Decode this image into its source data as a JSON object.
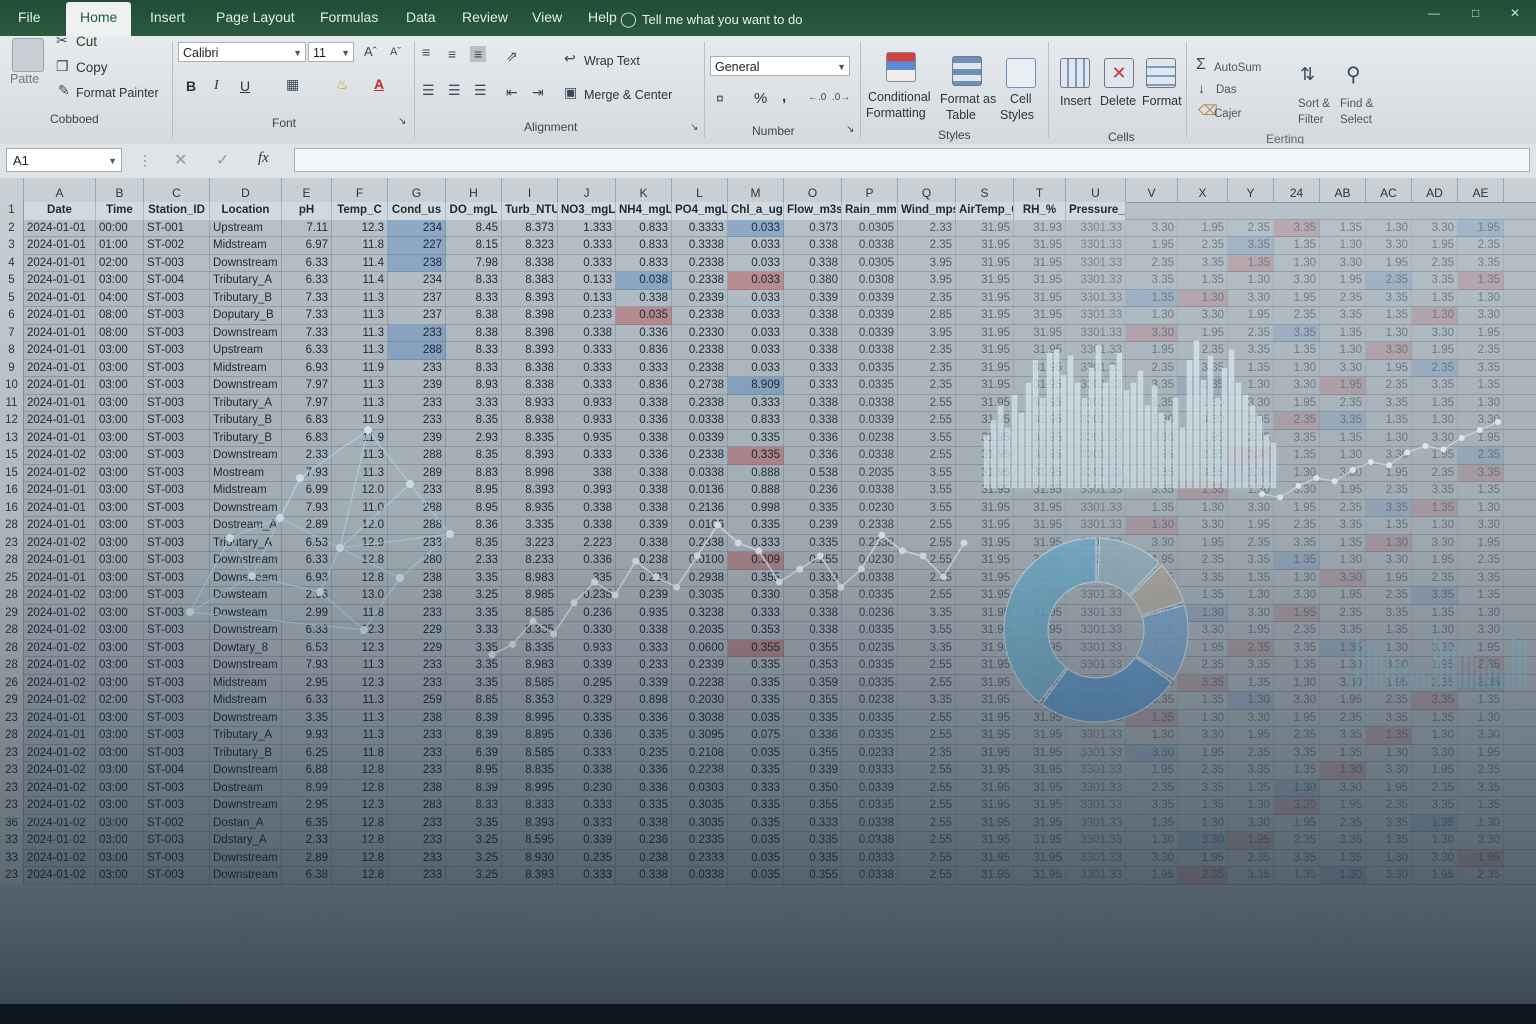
{
  "tabs": [
    "File",
    "Home",
    "Insert",
    "Page Layout",
    "Formulas",
    "Data",
    "Review",
    "View",
    "Help"
  ],
  "active_tab": "Home",
  "tell_me": "Tell me what you want to do",
  "clipboard": {
    "paste": "Patte",
    "cut": "Cut",
    "copy": "Copy",
    "format_painter": "Format Painter",
    "group": "Cobboed"
  },
  "font": {
    "family": "Calibri",
    "size": "11",
    "bold": "B",
    "italic": "I",
    "underline": "U",
    "group": "Font"
  },
  "alignment": {
    "wrap": "Wrap Text",
    "merge": "Merge & Center",
    "group": "Alignment"
  },
  "number": {
    "format": "General",
    "percent": "%",
    "comma": ",",
    "group": "Number"
  },
  "styles": {
    "cond_line1": "Conditional",
    "cond_line2": "Formatting",
    "fmt_table_line1": "Format as",
    "fmt_table_line2": "Table",
    "cell_line1": "Cell",
    "cell_line2": "Styles",
    "group": "Styles"
  },
  "cells": {
    "insert": "Insert",
    "delete": "Delete",
    "format": "Format",
    "group": "Cells"
  },
  "editing": {
    "autosum": "AutoSum",
    "fill": "Das",
    "clear": "Cajer",
    "sort_line1": "Sort &",
    "sort_line2": "Filter",
    "find_line1": "Find &",
    "find_line2": "Select",
    "group": "Eerting"
  },
  "name_box": "A1",
  "fx": "fx",
  "columns": [
    "A",
    "B",
    "C",
    "D",
    "E",
    "F",
    "G",
    "H",
    "I",
    "J",
    "K",
    "L",
    "M",
    "O",
    "P",
    "Q",
    "S",
    "T",
    "U",
    "V",
    "X",
    "Y",
    "24",
    "AB",
    "AC",
    "AD",
    "AE"
  ],
  "headers": [
    "Date",
    "Time",
    "Station_ID",
    "Location",
    "pH",
    "Temp_C",
    "Cond_us",
    "DO_mgL",
    "Turb_NTU",
    "NO3_mgL",
    "NH4_mgL",
    "PO4_mgL",
    "Chl_a_ugL",
    "Flow_m3s",
    "Rain_mm",
    "Wind_mps",
    "AirTemp_C",
    "RH_%",
    "Pressure_hPa"
  ],
  "row_numbers": [
    "2",
    "3",
    "4",
    "5",
    "5",
    "6",
    "7",
    "8",
    "9",
    "10",
    "11",
    "12",
    "13",
    "15",
    "15",
    "16",
    "16",
    "28",
    "23",
    "28",
    "25",
    "28",
    "29",
    "28",
    "28",
    "28",
    "26",
    "29",
    "23",
    "28",
    "23",
    "23",
    "23",
    "23",
    "36",
    "33",
    "33",
    "23"
  ],
  "rows": [
    [
      "2024-01-01",
      "00:00",
      "ST-001",
      "Upstream",
      "7.11",
      "12.3",
      "234",
      "8.45",
      "8.373",
      "1.333",
      "0.833",
      "0.3333",
      "0.033",
      "0.373",
      "0.0305",
      "2.33",
      "31.95",
      "31.93",
      "3301.33"
    ],
    [
      "2024-01-01",
      "01:00",
      "ST-002",
      "Midstream",
      "6.97",
      "11.8",
      "227",
      "8.15",
      "8.323",
      "0.333",
      "0.833",
      "0.3338",
      "0.033",
      "0.338",
      "0.0338",
      "2.35",
      "31.95",
      "31.95",
      "3301.33"
    ],
    [
      "2024-01-01",
      "02:00",
      "ST-003",
      "Downstream",
      "6.33",
      "11.4",
      "238",
      "7.98",
      "8.338",
      "0.333",
      "0.833",
      "0.2338",
      "0.033",
      "0.338",
      "0.0305",
      "3.95",
      "31.95",
      "31.95",
      "3301.33"
    ],
    [
      "2024-01-01",
      "03:00",
      "ST-004",
      "Tributary_A",
      "6.33",
      "11.4",
      "234",
      "8.33",
      "8.383",
      "0.133",
      "0.038",
      "0.2338",
      "0.033",
      "0.380",
      "0.0308",
      "3.95",
      "31.95",
      "31.95",
      "3301.33"
    ],
    [
      "2024-01-01",
      "04:00",
      "ST-003",
      "Tributary_B",
      "7.33",
      "11.3",
      "237",
      "8.33",
      "8.393",
      "0.133",
      "0.338",
      "0.2339",
      "0.033",
      "0.339",
      "0.0339",
      "2.35",
      "31.95",
      "31.95",
      "3301.33"
    ],
    [
      "2024-01-01",
      "08:00",
      "ST-003",
      "Doputary_B",
      "7.33",
      "11.3",
      "237",
      "8.38",
      "8.398",
      "0.233",
      "0.035",
      "0.2338",
      "0.033",
      "0.338",
      "0.0339",
      "2.85",
      "31.95",
      "31.95",
      "3301.33"
    ],
    [
      "2024-01-01",
      "08:00",
      "ST-003",
      "Downstream",
      "7.33",
      "11.3",
      "233",
      "8.38",
      "8.398",
      "0.338",
      "0.336",
      "0.2330",
      "0.033",
      "0.338",
      "0.0339",
      "3.95",
      "31.95",
      "31.95",
      "3301.33"
    ],
    [
      "2024-01-01",
      "03:00",
      "ST-003",
      "Upstream",
      "6.33",
      "11.3",
      "288",
      "8.33",
      "8.393",
      "0.333",
      "0.836",
      "0.2338",
      "0.033",
      "0.338",
      "0.0338",
      "2.35",
      "31.95",
      "31.95",
      "3301.33"
    ],
    [
      "2024-01-01",
      "03:00",
      "ST-003",
      "Midstream",
      "6.93",
      "11.9",
      "233",
      "8.33",
      "8.338",
      "0.333",
      "0.333",
      "0.2338",
      "0.033",
      "0.333",
      "0.0335",
      "2.35",
      "31.95",
      "31.95",
      "3301.33"
    ],
    [
      "2024-01-01",
      "03:00",
      "ST-003",
      "Downstream",
      "7.97",
      "11.3",
      "239",
      "8.93",
      "8.338",
      "0.333",
      "0.836",
      "0.2738",
      "8.909",
      "0.333",
      "0.0335",
      "2.35",
      "31.95",
      "31.95",
      "3301.33"
    ],
    [
      "2024-01-01",
      "03:00",
      "ST-003",
      "Tributary_A",
      "7.97",
      "11.3",
      "233",
      "3.33",
      "8.933",
      "0.933",
      "0.338",
      "0.2338",
      "0.333",
      "0.338",
      "0.0338",
      "2.55",
      "31.95",
      "31.95",
      "3301.33"
    ],
    [
      "2024-01-01",
      "03:00",
      "ST-003",
      "Tributary_B",
      "6.83",
      "11.9",
      "233",
      "8.35",
      "8.938",
      "0.933",
      "0.336",
      "0.0338",
      "0.833",
      "0.338",
      "0.0339",
      "2.55",
      "31.95",
      "31.95",
      "3301.33"
    ],
    [
      "2024-01-01",
      "03:00",
      "ST-003",
      "Tributary_B",
      "6.83",
      "11.9",
      "239",
      "2.93",
      "8.335",
      "0.935",
      "0.338",
      "0.0339",
      "0.335",
      "0.336",
      "0.0238",
      "3.55",
      "31.95",
      "31.95",
      "3301.33"
    ],
    [
      "2024-01-02",
      "03:00",
      "ST-003",
      "Downstream",
      "2.33",
      "11.3",
      "288",
      "8.35",
      "8.393",
      "0.333",
      "0.336",
      "0.2338",
      "0.335",
      "0.336",
      "0.0338",
      "2.55",
      "31.95",
      "31.95",
      "3301.33"
    ],
    [
      "2024-01-02",
      "03:00",
      "ST-003",
      "Mostream",
      "7.93",
      "11.3",
      "289",
      "8.83",
      "8.998",
      "338",
      "0.338",
      "0.0338",
      "0.888",
      "0.538",
      "0.2035",
      "3.55",
      "31.95",
      "31.95",
      "3301.33"
    ],
    [
      "2024-01-01",
      "03:00",
      "ST-003",
      "Midstream",
      "6.99",
      "12.0",
      "233",
      "8.95",
      "8.393",
      "0.393",
      "0.338",
      "0.0136",
      "0.888",
      "0.236",
      "0.0338",
      "3.55",
      "31.95",
      "31.95",
      "3301.33"
    ],
    [
      "2024-01-01",
      "03:00",
      "ST-003",
      "Downstream",
      "7.93",
      "11.0",
      "288",
      "8.95",
      "8.935",
      "0.338",
      "0.338",
      "0.2136",
      "0.998",
      "0.335",
      "0.0230",
      "3.55",
      "31.95",
      "31.95",
      "3301.33"
    ],
    [
      "2024-01-01",
      "03:00",
      "ST-003",
      "Dostream_A",
      "2.89",
      "12.0",
      "288",
      "8.36",
      "3.335",
      "0.338",
      "0.339",
      "0.0106",
      "0.335",
      "0.239",
      "0.2338",
      "2.55",
      "31.95",
      "31.95",
      "3301.33"
    ],
    [
      "2024-01-02",
      "03:00",
      "ST-003",
      "Tributary_A",
      "6.53",
      "12.9",
      "233",
      "8.35",
      "3.223",
      "2.223",
      "0.338",
      "0.2338",
      "0.333",
      "0.335",
      "0.2338",
      "2.55",
      "31.95",
      "31.95",
      "3301.33"
    ],
    [
      "2024-01-01",
      "03:00",
      "ST-003",
      "Downstream",
      "6.33",
      "12.8",
      "280",
      "2.33",
      "8.233",
      "0.336",
      "0.238",
      "0.0100",
      "0.309",
      "0.255",
      "0.0230",
      "2.55",
      "31.95",
      "31.95",
      "3301.33"
    ],
    [
      "2024-01-01",
      "03:00",
      "ST-003",
      "Downstream",
      "6.93",
      "12.8",
      "238",
      "3.35",
      "8.983",
      "335",
      "0.233",
      "0.2938",
      "0.355",
      "0.339",
      "0.0338",
      "2.55",
      "31.95",
      "31.95",
      "3301.33"
    ],
    [
      "2024-01-02",
      "03:00",
      "ST-003",
      "Dowsteam",
      "2.96",
      "13.0",
      "238",
      "3.25",
      "8.985",
      "0.235",
      "0.239",
      "0.3035",
      "0.330",
      "0.358",
      "0.0335",
      "2.55",
      "31.95",
      "31.95",
      "3301.33"
    ],
    [
      "2024-01-02",
      "03:00",
      "ST-003",
      "Dowsteam",
      "2.99",
      "11.8",
      "233",
      "3.35",
      "8.585",
      "0.236",
      "0.935",
      "0.3238",
      "0.333",
      "0.338",
      "0.0236",
      "3.35",
      "31.95",
      "31.95",
      "3301.33"
    ],
    [
      "2024-01-02",
      "03:00",
      "ST-003",
      "Downstream",
      "6.33",
      "12.3",
      "229",
      "3.33",
      "8.335",
      "0.330",
      "0.338",
      "0.2035",
      "0.353",
      "0.338",
      "0.0335",
      "3.55",
      "31.95",
      "31.95",
      "3301.33"
    ],
    [
      "2024-01-02",
      "03:00",
      "ST-003",
      "Dowtary_8",
      "6.53",
      "12.3",
      "229",
      "3.35",
      "8.335",
      "0.933",
      "0.333",
      "0.0600",
      "0.355",
      "0.355",
      "0.0235",
      "3.35",
      "31.95",
      "31.95",
      "3301.33"
    ],
    [
      "2024-01-02",
      "03:00",
      "ST-003",
      "Downstream",
      "7.93",
      "11.3",
      "233",
      "3.35",
      "8.983",
      "0.339",
      "0.233",
      "0.2339",
      "0.335",
      "0.353",
      "0.0335",
      "2.55",
      "31.95",
      "31.95",
      "3301.33"
    ],
    [
      "2024-01-02",
      "03:00",
      "ST-003",
      "Midstream",
      "2.95",
      "12.3",
      "233",
      "3.35",
      "8.585",
      "0.295",
      "0.339",
      "0.2238",
      "0.335",
      "0.359",
      "0.0335",
      "2.55",
      "31.95",
      "31.95",
      "3301.33"
    ],
    [
      "2024-01-02",
      "02:00",
      "ST-003",
      "Midstream",
      "6.33",
      "11.3",
      "259",
      "8.85",
      "8.353",
      "0.329",
      "0.898",
      "0.2030",
      "0.335",
      "0.355",
      "0.0238",
      "3.35",
      "31.95",
      "31.95",
      "3301.33"
    ],
    [
      "2024-01-01",
      "03:00",
      "ST-003",
      "Downstream",
      "3.35",
      "11.3",
      "238",
      "8.39",
      "8.995",
      "0.335",
      "0.336",
      "0.3038",
      "0.035",
      "0.335",
      "0.0335",
      "2.55",
      "31.95",
      "31.95",
      "3301.33"
    ],
    [
      "2024-01-01",
      "03:00",
      "ST-003",
      "Tributary_A",
      "9.93",
      "11.3",
      "233",
      "8.39",
      "8.895",
      "0.336",
      "0.335",
      "0.3095",
      "0.075",
      "0.336",
      "0.0335",
      "2.55",
      "31.95",
      "31.95",
      "3301.33"
    ],
    [
      "2024-01-02",
      "03:00",
      "ST-003",
      "Tributary_B",
      "6.25",
      "11.8",
      "233",
      "6.39",
      "8.585",
      "0.333",
      "0.235",
      "0.2108",
      "0.035",
      "0.355",
      "0.0233",
      "2.35",
      "31.95",
      "31.95",
      "3301.33"
    ],
    [
      "2024-01-02",
      "03:00",
      "ST-004",
      "Downstream",
      "6.88",
      "12.8",
      "233",
      "8.95",
      "8.835",
      "0.338",
      "0.336",
      "0.2238",
      "0.335",
      "0.339",
      "0.0333",
      "2.55",
      "31.95",
      "31.95",
      "3301.33"
    ],
    [
      "2024-01-02",
      "03:00",
      "ST-003",
      "Dostream",
      "8.99",
      "12.8",
      "238",
      "8.39",
      "8.995",
      "0.230",
      "0.336",
      "0.0303",
      "0.333",
      "0.350",
      "0.0339",
      "2.55",
      "31.95",
      "31.95",
      "3301.33"
    ],
    [
      "2024-01-02",
      "03:00",
      "ST-003",
      "Downstream",
      "2.95",
      "12.3",
      "283",
      "8.33",
      "8.333",
      "0.333",
      "0.335",
      "0.3035",
      "0.335",
      "0.355",
      "0.0335",
      "2.55",
      "31.95",
      "31.95",
      "3301.33"
    ],
    [
      "2024-01-02",
      "03:00",
      "ST-002",
      "Dostan_A",
      "6.35",
      "12.8",
      "233",
      "3.35",
      "8.393",
      "0.333",
      "0.338",
      "0.3035",
      "0.335",
      "0.333",
      "0.0338",
      "2.55",
      "31.95",
      "31.95",
      "3301.33"
    ],
    [
      "2024-01-02",
      "03:00",
      "ST-003",
      "Ddstary_A",
      "2.33",
      "12.8",
      "233",
      "3.25",
      "8.595",
      "0.339",
      "0.236",
      "0.2335",
      "0.035",
      "0.335",
      "0.0338",
      "2.55",
      "31.95",
      "31.95",
      "3301.33"
    ],
    [
      "2024-01-02",
      "03:00",
      "ST-003",
      "Downstream",
      "2.89",
      "12.8",
      "233",
      "3.25",
      "8.930",
      "0.235",
      "0.238",
      "0.2333",
      "0.035",
      "0.335",
      "0.0333",
      "2.55",
      "31.95",
      "31.95",
      "3301.33"
    ],
    [
      "2024-01-02",
      "03:00",
      "ST-003",
      "Downstream",
      "6.38",
      "12.8",
      "233",
      "3.25",
      "8.393",
      "0.333",
      "0.338",
      "0.0338",
      "0.035",
      "0.355",
      "0.0338",
      "2.55",
      "31.95",
      "31.95",
      "3301.33"
    ]
  ],
  "right_values": [
    "1.30",
    "3.30",
    "1.95",
    "2.35",
    "3.35",
    "1.35"
  ],
  "colors": {
    "ribbon_green": "#1f4d36",
    "highlight_blue": "#4682c8",
    "highlight_red": "#c84646",
    "viz_cyan": "#7fd6f0"
  },
  "chart_data": [
    {
      "type": "bar",
      "title": "",
      "values": [
        0.35,
        0.45,
        0.55,
        0.4,
        0.62,
        0.5,
        0.7,
        0.85,
        0.6,
        0.9,
        0.92,
        0.75,
        0.88,
        0.7,
        0.6,
        0.8,
        0.95,
        0.7,
        0.82,
        0.9,
        0.65,
        0.7,
        0.78,
        0.55,
        0.68,
        0.5,
        0.45,
        0.6,
        0.4,
        0.85,
        0.98,
        0.72,
        0.88,
        0.6,
        0.8,
        0.92,
        0.7,
        0.62,
        0.55,
        0.48,
        0.35,
        0.3
      ]
    },
    {
      "type": "pie",
      "title": "",
      "values": [
        12,
        8,
        14,
        26,
        40
      ]
    },
    {
      "type": "line",
      "title": "",
      "values": [
        0.32,
        0.36,
        0.45,
        0.4,
        0.52,
        0.6,
        0.55,
        0.68,
        0.62,
        0.58,
        0.7,
        0.82,
        0.75,
        0.72,
        0.6,
        0.65,
        0.7,
        0.58,
        0.65,
        0.78,
        0.72,
        0.7,
        0.62,
        0.75
      ]
    },
    {
      "type": "line",
      "title": "",
      "values": [
        0.4,
        0.38,
        0.45,
        0.5,
        0.48,
        0.55,
        0.6,
        0.58,
        0.66,
        0.7,
        0.68,
        0.75,
        0.8,
        0.85
      ]
    }
  ]
}
